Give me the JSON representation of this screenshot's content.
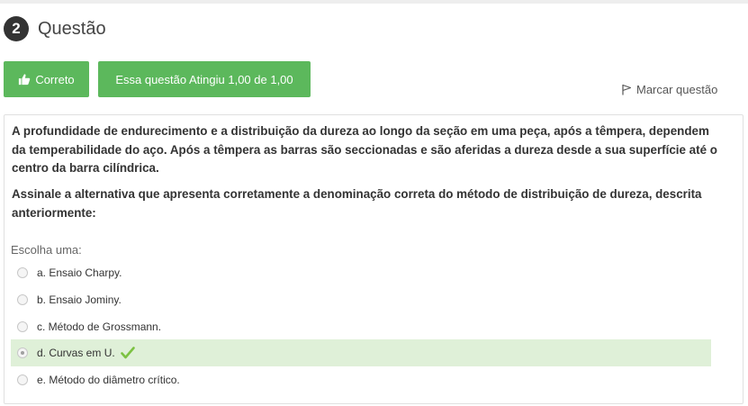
{
  "question": {
    "number": "2",
    "title": "Questão"
  },
  "status": {
    "correct_label": "Correto",
    "score_label": "Essa questão Atingiu 1,00 de 1,00",
    "flag_label": "Marcar questão"
  },
  "text": {
    "paragraph1": "A profundidade de endurecimento e a distribuição da dureza ao longo da seção em uma peça, após a têmpera, dependem da temperabilidade do aço. Após a têmpera as barras são seccionadas e são aferidas a dureza desde a sua superfície até o centro da barra cilíndrica.",
    "paragraph2": "Assinale a alternativa que apresenta corretamente a denominação correta do método de distribuição de dureza, descrita anteriormente:"
  },
  "answer": {
    "choose_label": "Escolha uma:",
    "options": [
      {
        "label": "a. Ensaio Charpy.",
        "selected": false
      },
      {
        "label": "b. Ensaio Jominy.",
        "selected": false
      },
      {
        "label": "c. Método de Grossmann.",
        "selected": false
      },
      {
        "label": "d. Curvas em U.",
        "selected": true,
        "correct": true
      },
      {
        "label": "e. Método do diâmetro crítico.",
        "selected": false
      }
    ]
  },
  "colors": {
    "success": "#5cb85c",
    "selected_bg": "#dff0d8",
    "checkmark": "#7cc242"
  },
  "icons": {
    "thumb": "thumbs-up-icon",
    "flag": "flag-icon",
    "check": "check-icon"
  }
}
